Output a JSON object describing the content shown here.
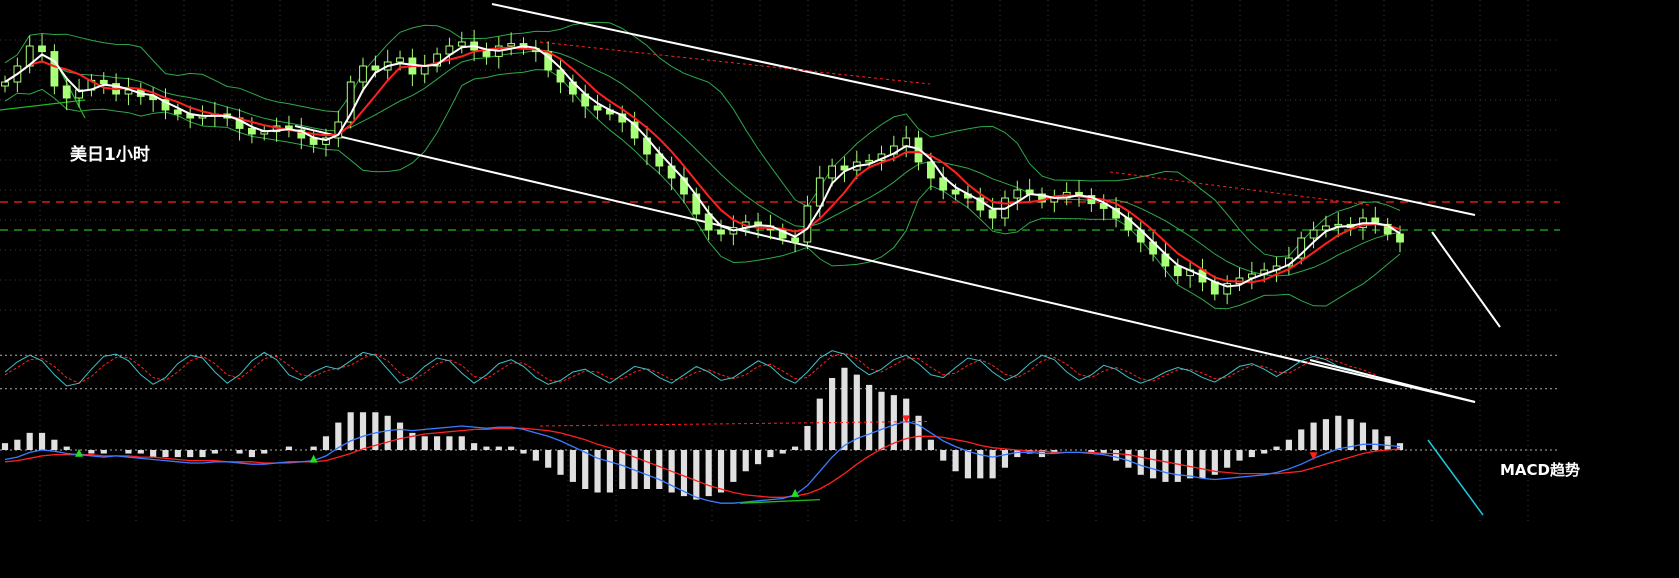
{
  "chart_data": {
    "type": "candlestick",
    "title": "美日1小时",
    "macd_label": "MACD趋势",
    "grid": true,
    "colors": {
      "background": "#000000",
      "grid": "#3a3a3a",
      "candle": "#a8ff78",
      "bollinger": "#2fa84a",
      "ma_fast": "#ffffff",
      "ma_slow": "#ff2020",
      "channel": "#ffffff",
      "resistance": "#ff2020",
      "support": "#1fb81f",
      "kd_k": "#40c0c8",
      "kd_d": "#ff2020",
      "macd_dif": "#3a7bff",
      "macd_dea": "#ff2020",
      "macd_bar": "#e0e0e0",
      "arrow_up": "#1fe01f",
      "arrow_down": "#ff2020",
      "trend_macd": "#20c8e0"
    },
    "price_close": [
      112.4,
      112.6,
      112.85,
      112.78,
      112.35,
      112.2,
      112.3,
      112.42,
      112.38,
      112.25,
      112.3,
      112.22,
      112.18,
      112.05,
      112.0,
      111.95,
      111.98,
      112.0,
      111.95,
      111.82,
      111.75,
      111.78,
      111.85,
      111.8,
      111.7,
      111.62,
      111.7,
      111.9,
      112.4,
      112.6,
      112.55,
      112.65,
      112.7,
      112.5,
      112.6,
      112.75,
      112.85,
      112.9,
      112.8,
      112.72,
      112.85,
      112.88,
      112.82,
      112.78,
      112.55,
      112.4,
      112.25,
      112.1,
      112.05,
      112.0,
      111.9,
      111.7,
      111.5,
      111.35,
      111.2,
      111.0,
      110.75,
      110.55,
      110.5,
      110.58,
      110.65,
      110.6,
      110.55,
      110.45,
      110.4,
      110.85,
      111.2,
      111.35,
      111.3,
      111.4,
      111.42,
      111.5,
      111.6,
      111.7,
      111.4,
      111.2,
      111.05,
      111.0,
      110.95,
      110.8,
      110.7,
      110.95,
      111.05,
      111.0,
      110.9,
      110.95,
      111.02,
      110.98,
      110.88,
      110.82,
      110.7,
      110.55,
      110.4,
      110.25,
      110.1,
      109.98,
      110.05,
      109.9,
      109.75,
      109.88,
      109.95,
      110.0,
      110.05,
      110.1,
      110.2,
      110.45,
      110.55,
      110.6,
      110.62,
      110.58,
      110.7,
      110.62,
      110.5,
      110.4
    ],
    "kd": {
      "k": [
        50,
        68,
        80,
        70,
        45,
        25,
        30,
        55,
        78,
        82,
        70,
        45,
        28,
        40,
        65,
        80,
        75,
        50,
        30,
        45,
        70,
        85,
        72,
        45,
        35,
        50,
        60,
        55,
        70,
        85,
        80,
        55,
        30,
        40,
        60,
        75,
        70,
        48,
        30,
        45,
        65,
        72,
        60,
        40,
        28,
        35,
        50,
        55,
        42,
        30,
        45,
        60,
        55,
        40,
        30,
        45,
        60,
        50,
        35,
        40,
        55,
        70,
        60,
        40,
        30,
        50,
        75,
        88,
        82,
        60,
        45,
        55,
        72,
        80,
        65,
        45,
        40,
        58,
        75,
        70,
        50,
        35,
        45,
        65,
        80,
        72,
        50,
        35,
        45,
        62,
        55,
        40,
        30,
        38,
        50,
        58,
        52,
        40,
        32,
        45,
        60,
        65,
        55,
        42,
        55,
        70,
        78,
        72,
        60,
        55,
        48,
        40
      ],
      "d": [
        45,
        58,
        72,
        74,
        60,
        40,
        30,
        42,
        62,
        76,
        76,
        60,
        40,
        35,
        50,
        70,
        78,
        65,
        45,
        38,
        55,
        74,
        78,
        62,
        45,
        42,
        52,
        57,
        62,
        75,
        82,
        70,
        48,
        35,
        48,
        65,
        72,
        62,
        42,
        38,
        52,
        66,
        66,
        52,
        36,
        32,
        42,
        52,
        50,
        38,
        38,
        50,
        56,
        48,
        36,
        38,
        50,
        54,
        45,
        38,
        45,
        60,
        64,
        52,
        38,
        40,
        60,
        78,
        84,
        74,
        56,
        50,
        62,
        75,
        74,
        58,
        45,
        48,
        62,
        72,
        62,
        46,
        40,
        52,
        70,
        76,
        64,
        46,
        40,
        52,
        58,
        50,
        38,
        34,
        44,
        54,
        55,
        48,
        38,
        40,
        52,
        62,
        60,
        50,
        48,
        60,
        72,
        75,
        68,
        60,
        54,
        45
      ],
      "upper_level": 80,
      "lower_level": 20
    },
    "macd": {
      "dif": [
        -0.08,
        -0.06,
        -0.02,
        0.0,
        -0.01,
        -0.03,
        -0.04,
        -0.05,
        -0.06,
        -0.05,
        -0.06,
        -0.07,
        -0.08,
        -0.09,
        -0.1,
        -0.11,
        -0.11,
        -0.1,
        -0.1,
        -0.11,
        -0.12,
        -0.12,
        -0.11,
        -0.1,
        -0.1,
        -0.09,
        -0.05,
        0.02,
        0.08,
        0.12,
        0.15,
        0.17,
        0.18,
        0.17,
        0.18,
        0.19,
        0.2,
        0.21,
        0.2,
        0.19,
        0.2,
        0.2,
        0.18,
        0.15,
        0.12,
        0.08,
        0.03,
        -0.02,
        -0.07,
        -0.1,
        -0.13,
        -0.17,
        -0.21,
        -0.25,
        -0.3,
        -0.35,
        -0.4,
        -0.43,
        -0.45,
        -0.45,
        -0.44,
        -0.43,
        -0.42,
        -0.41,
        -0.38,
        -0.3,
        -0.18,
        -0.06,
        0.04,
        0.1,
        0.14,
        0.18,
        0.22,
        0.25,
        0.22,
        0.15,
        0.08,
        0.03,
        -0.01,
        -0.04,
        -0.06,
        -0.04,
        -0.02,
        -0.02,
        -0.03,
        -0.03,
        -0.02,
        -0.02,
        -0.03,
        -0.04,
        -0.06,
        -0.09,
        -0.13,
        -0.16,
        -0.19,
        -0.21,
        -0.22,
        -0.24,
        -0.25,
        -0.24,
        -0.23,
        -0.22,
        -0.21,
        -0.19,
        -0.16,
        -0.12,
        -0.07,
        -0.03,
        0.01,
        0.03,
        0.05,
        0.05,
        0.04,
        0.03
      ],
      "dea": [
        -0.1,
        -0.09,
        -0.07,
        -0.05,
        -0.04,
        -0.04,
        -0.04,
        -0.04,
        -0.05,
        -0.05,
        -0.05,
        -0.06,
        -0.06,
        -0.07,
        -0.08,
        -0.09,
        -0.09,
        -0.09,
        -0.1,
        -0.1,
        -0.1,
        -0.11,
        -0.11,
        -0.11,
        -0.1,
        -0.1,
        -0.09,
        -0.06,
        -0.03,
        0.01,
        0.04,
        0.07,
        0.1,
        0.12,
        0.14,
        0.15,
        0.16,
        0.17,
        0.18,
        0.18,
        0.19,
        0.19,
        0.19,
        0.18,
        0.17,
        0.15,
        0.12,
        0.09,
        0.05,
        0.02,
        -0.02,
        -0.06,
        -0.1,
        -0.14,
        -0.18,
        -0.22,
        -0.26,
        -0.3,
        -0.33,
        -0.36,
        -0.38,
        -0.39,
        -0.4,
        -0.4,
        -0.39,
        -0.37,
        -0.33,
        -0.27,
        -0.2,
        -0.12,
        -0.05,
        0.01,
        0.06,
        0.1,
        0.12,
        0.12,
        0.11,
        0.09,
        0.07,
        0.04,
        0.02,
        0.01,
        0.0,
        -0.01,
        -0.01,
        -0.02,
        -0.02,
        -0.02,
        -0.02,
        -0.03,
        -0.03,
        -0.04,
        -0.06,
        -0.08,
        -0.1,
        -0.12,
        -0.14,
        -0.16,
        -0.18,
        -0.19,
        -0.2,
        -0.2,
        -0.2,
        -0.2,
        -0.19,
        -0.18,
        -0.15,
        -0.12,
        -0.09,
        -0.06,
        -0.03,
        -0.01,
        0.0,
        0.01
      ],
      "buy_arrows": [
        8,
        31,
        79
      ],
      "sell_arrows": [
        90,
        131
      ]
    },
    "ylim_price": [
      109.3,
      113.3
    ],
    "ylim_kd": [
      0,
      100
    ],
    "ylim_macd": [
      -0.55,
      0.35
    ]
  }
}
